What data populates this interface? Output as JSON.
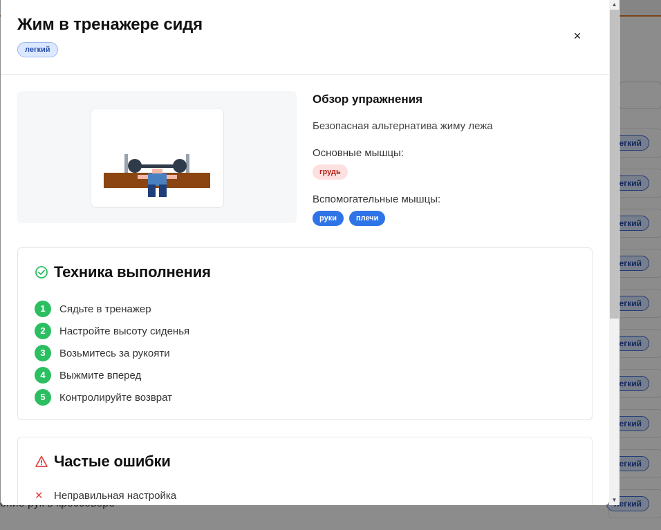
{
  "background": {
    "row_badge": "легкий",
    "bottom_row_text": "ение рук в кроссовере"
  },
  "modal": {
    "title": "Жим в тренажере сидя",
    "difficulty": "легкий",
    "close_label": "×",
    "overview": {
      "title": "Обзор упражнения",
      "description": "Безопасная альтернатива жиму лежа",
      "primary_label": "Основные мышцы:",
      "primary_muscles": [
        "грудь"
      ],
      "secondary_label": "Вспомогательные мышцы:",
      "secondary_muscles": [
        "руки",
        "плечи"
      ]
    },
    "technique": {
      "title": "Техника выполнения",
      "steps": [
        {
          "num": "1",
          "text": "Сядьте в тренажер"
        },
        {
          "num": "2",
          "text": "Настройте высоту сиденья"
        },
        {
          "num": "3",
          "text": "Возьмитесь за рукояти"
        },
        {
          "num": "4",
          "text": "Выжмите вперед"
        },
        {
          "num": "5",
          "text": "Контролируйте возврат"
        }
      ]
    },
    "mistakes": {
      "title": "Частые ошибки",
      "items": [
        "Неправильная настройка"
      ]
    }
  },
  "colors": {
    "accent_green": "#2bbf62",
    "accent_blue": "#2f74e6",
    "warning_red": "#e04646"
  }
}
